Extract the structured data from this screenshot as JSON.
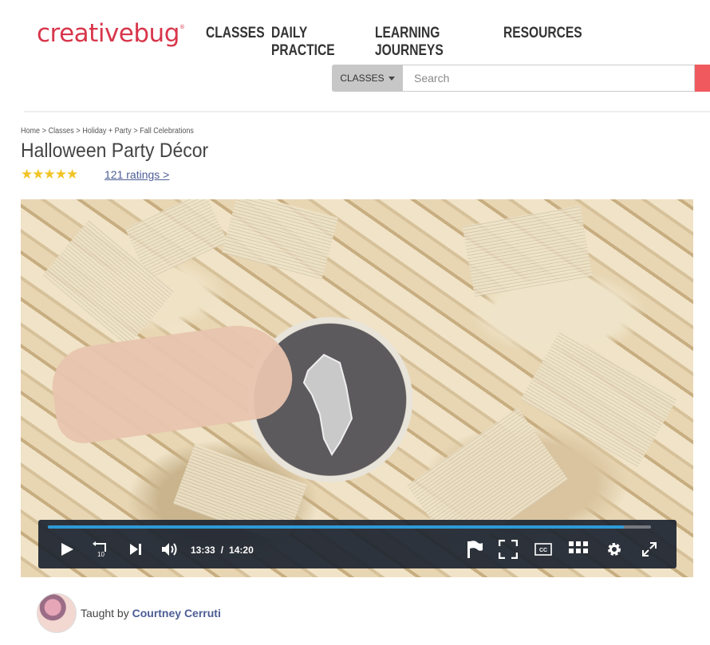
{
  "brand": {
    "logo_text": "creativebug",
    "logo_mark": "®"
  },
  "nav": {
    "items": [
      {
        "label": "CLASSES"
      },
      {
        "label": "DAILY PRACTICE"
      },
      {
        "label": "LEARNING JOURNEYS"
      },
      {
        "label": "RESOURCES"
      }
    ]
  },
  "search": {
    "category_label": "CLASSES",
    "placeholder": "Search"
  },
  "breadcrumb": {
    "items": [
      "Home",
      "Classes",
      "Holiday + Party",
      "Fall Celebrations"
    ],
    "separator": ">"
  },
  "page": {
    "title": "Halloween Party Décor",
    "stars": "★★★★★",
    "ratings_link": "121 ratings >"
  },
  "player": {
    "current_time": "13:33",
    "separator": "/",
    "duration": "14:20",
    "progress_fraction": 0.955,
    "cc_label": "CC",
    "skip_back_label": "10",
    "progress_color": "#2e9bd6"
  },
  "teacher": {
    "prefix": "Taught by",
    "name": "Courtney Cerruti"
  },
  "colors": {
    "brand_red": "#d8364b",
    "link_blue": "#4c5d94",
    "star_gold": "#f2c325"
  }
}
